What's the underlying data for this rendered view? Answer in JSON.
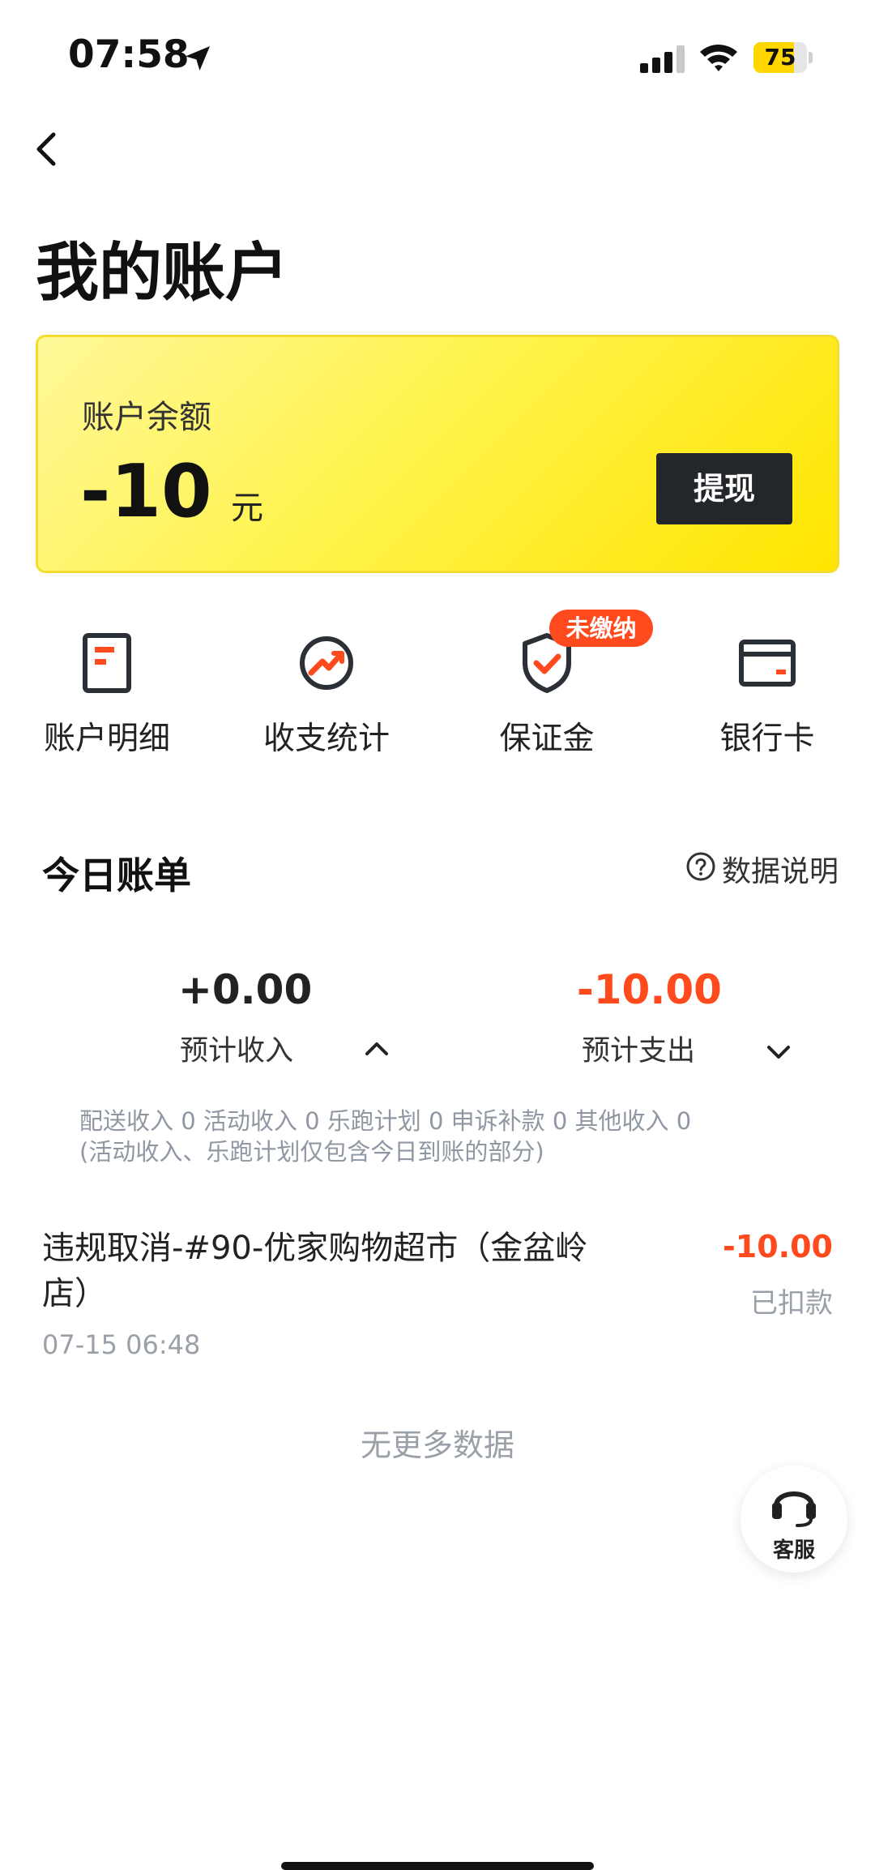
{
  "status_bar": {
    "time": "07:58",
    "battery": "75",
    "battery_level": 0.75
  },
  "header": {
    "title": "我的账户"
  },
  "balance_card": {
    "label": "账户余额",
    "amount": "-10",
    "unit": "元",
    "withdraw_label": "提现"
  },
  "quick_actions": [
    {
      "label": "账户明细",
      "icon": "document-icon"
    },
    {
      "label": "收支统计",
      "icon": "trend-chart-icon"
    },
    {
      "label": "保证金",
      "icon": "shield-check-icon",
      "badge": "未缴纳"
    },
    {
      "label": "银行卡",
      "icon": "bank-card-icon"
    }
  ],
  "today_bill": {
    "title": "今日账单",
    "help_label": "数据说明",
    "income": {
      "amount": "+0.00",
      "label": "预计收入"
    },
    "expense": {
      "amount": "-10.00",
      "label": "预计支出"
    },
    "breakdown_line1": "配送收入 0  活动收入 0  乐跑计划 0  申诉补款 0  其他收入 0",
    "breakdown_line2": "(活动收入、乐跑计划仅包含今日到账的部分)"
  },
  "transactions": [
    {
      "title": "违规取消-#90-优家购物超市（金盆岭店）",
      "time": "07-15 06:48",
      "amount": "-10.00",
      "status": "已扣款"
    }
  ],
  "no_more_label": "无更多数据",
  "customer_service": {
    "label": "客服"
  },
  "colors": {
    "accent_yellow": "#ffe500",
    "alert_red": "#ff4a1d",
    "dark_button": "#23262b"
  }
}
